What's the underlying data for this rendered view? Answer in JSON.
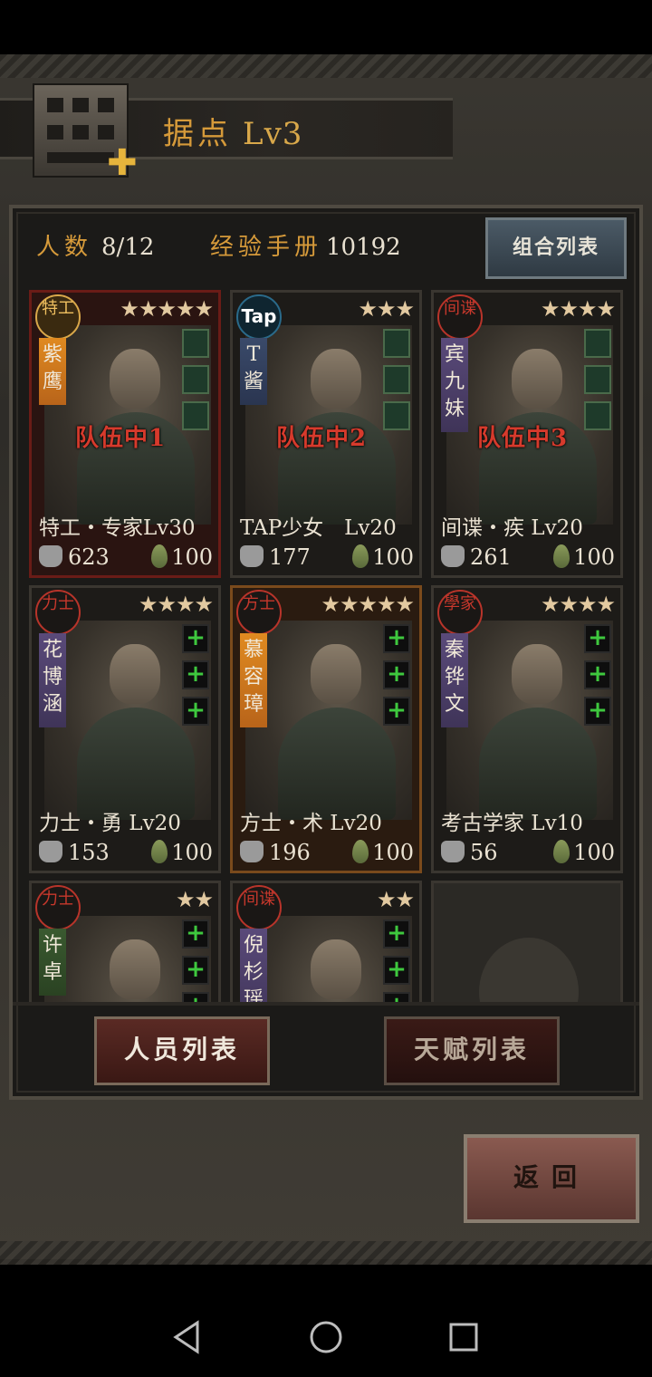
{
  "header": {
    "title": "据点",
    "level": "Lv3"
  },
  "stats": {
    "count_label": "人数",
    "count_value": "8/12",
    "exp_label": "经验手册",
    "exp_value": "10192"
  },
  "buttons": {
    "combo": "组合列表",
    "personnel": "人员列表",
    "talent": "天赋列表",
    "back": "返回"
  },
  "cards": [
    {
      "badge": "特工",
      "stars": "★★★★★",
      "name": "紫鹰",
      "info": "特工・专家Lv30",
      "power": "623",
      "water": "100",
      "team": "队伍中1"
    },
    {
      "badge": "Tap",
      "stars": "★★★",
      "name": "T酱",
      "info": "TAP少女　Lv20",
      "power": "177",
      "water": "100",
      "team": "队伍中2"
    },
    {
      "badge": "间谍",
      "stars": "★★★★",
      "name": "宾九妹",
      "info": "间谍・疾 Lv20",
      "power": "261",
      "water": "100",
      "team": "队伍中3"
    },
    {
      "badge": "力士",
      "stars": "★★★★",
      "name": "花博涵",
      "info": "力士・勇 Lv20",
      "power": "153",
      "water": "100"
    },
    {
      "badge": "方士",
      "stars": "★★★★★",
      "name": "慕容璋",
      "info": "方士・术 Lv20",
      "power": "196",
      "water": "100"
    },
    {
      "badge": "學家",
      "stars": "★★★★",
      "name": "秦铧文",
      "info": "考古学家 Lv10",
      "power": "56",
      "water": "100"
    },
    {
      "badge": "力士",
      "stars": "★★",
      "name": "许卓"
    },
    {
      "badge": "间谍",
      "stars": "★★",
      "name": "倪杉瑶"
    }
  ],
  "colors": {
    "accent": "#d69a3a",
    "team_red": "#d63a2c",
    "plus_green": "#3ec83e"
  }
}
